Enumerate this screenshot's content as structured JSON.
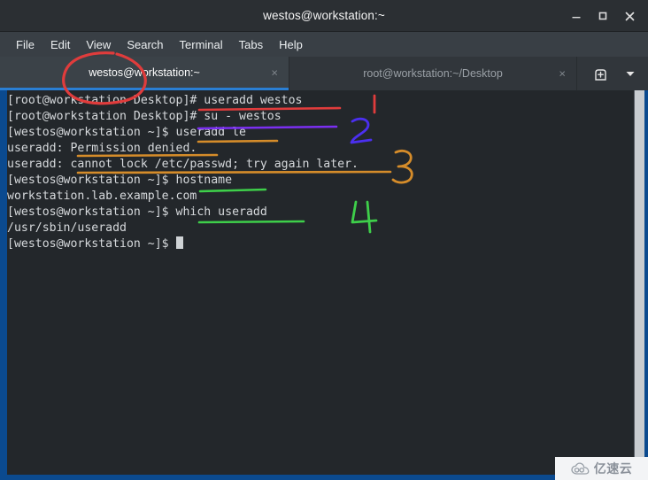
{
  "window": {
    "title": "westos@workstation:~",
    "controls": [
      {
        "name": "minimize",
        "glyph": "minimize-icon"
      },
      {
        "name": "maximize",
        "glyph": "maximize-icon"
      },
      {
        "name": "close",
        "glyph": "close-icon"
      }
    ]
  },
  "menubar": {
    "items": [
      {
        "label": "File"
      },
      {
        "label": "Edit"
      },
      {
        "label": "View"
      },
      {
        "label": "Search"
      },
      {
        "label": "Terminal"
      },
      {
        "label": "Tabs"
      },
      {
        "label": "Help"
      }
    ]
  },
  "tabs": [
    {
      "label": "westos@workstation:~",
      "active": true,
      "close": "×"
    },
    {
      "label": "root@workstation:~/Desktop",
      "active": false,
      "close": "×"
    }
  ],
  "tabbar_actions": {
    "new_tab": "new-tab-icon",
    "tab_list": "chevron-down-icon"
  },
  "terminal": {
    "lines": [
      {
        "text": "[root@workstation Desktop]# useradd westos"
      },
      {
        "text": "[root@workstation Desktop]# su - westos"
      },
      {
        "text": "[westos@workstation ~]$ useradd le"
      },
      {
        "text": "useradd: Permission denied."
      },
      {
        "text": "useradd: cannot lock /etc/passwd; try again later."
      },
      {
        "text": "[westos@workstation ~]$ hostname"
      },
      {
        "text": "workstation.lab.example.com"
      },
      {
        "text": "[westos@workstation ~]$ which useradd"
      },
      {
        "text": "/usr/sbin/useradd"
      },
      {
        "text": "[westos@workstation ~]$ ",
        "cursor": true
      }
    ]
  },
  "annotations": {
    "circle": {
      "target": "active-tab",
      "color": "#e03c3c"
    },
    "underlines": [
      {
        "target": "useradd westos",
        "color": "#e03c3c"
      },
      {
        "target": "su - westos",
        "color": "#7b2ff2"
      },
      {
        "target": "useradd le",
        "color": "#d58c2a"
      },
      {
        "target": "Permission denied.",
        "color": "#d58c2a"
      },
      {
        "target": "cannot lock /etc/passwd; try again later.",
        "color": "#d58c2a"
      },
      {
        "target": "workstation.lab.example.com",
        "color": "#3ecf4a"
      },
      {
        "target": "which useradd",
        "color": "#3ecf4a"
      }
    ],
    "numbers": [
      {
        "label": "1",
        "color": "#e03c3c"
      },
      {
        "label": "2",
        "color": "#4b2ff0"
      },
      {
        "label": "3",
        "color": "#d58c2a"
      },
      {
        "label": "4",
        "color": "#3ecf4a"
      }
    ]
  },
  "watermark": {
    "text": "亿速云",
    "icon": "cloud-icon"
  },
  "colors": {
    "titlebar": "#2b2f33",
    "menubar": "#393f45",
    "tabbar": "#31363b",
    "terminal_bg": "#23272b",
    "window_border": "#0b4a8f",
    "accent": "#2a7fd4"
  }
}
